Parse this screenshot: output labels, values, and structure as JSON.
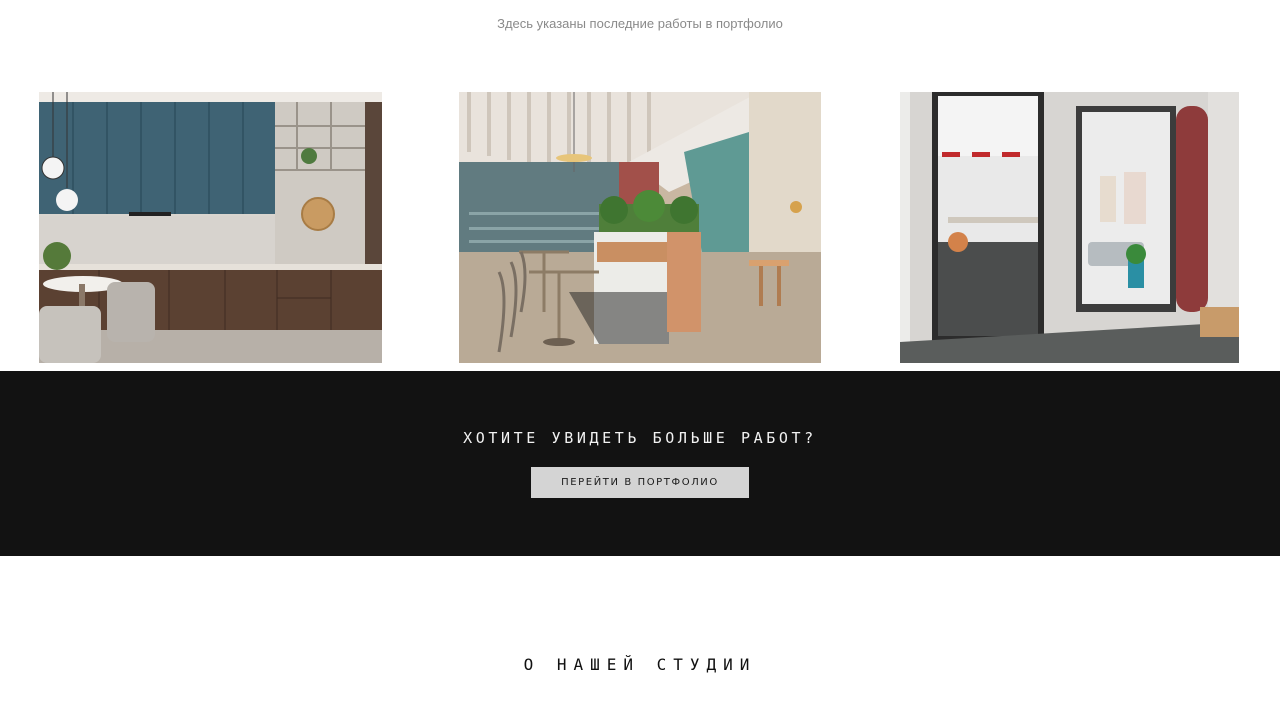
{
  "portfolio": {
    "subtitle": "Здесь указаны последние работы в портфолио",
    "items": [
      {
        "name": "kitchen-interior"
      },
      {
        "name": "restaurant-interior"
      },
      {
        "name": "office-interior"
      }
    ]
  },
  "cta": {
    "title": "ХОТИТЕ УВИДЕТЬ БОЛЬШЕ РАБОТ?",
    "button_label": "ПЕРЕЙТИ В ПОРТФОЛИО",
    "background_color": "#121212",
    "button_color": "#d4d4d4"
  },
  "about": {
    "title": "О НАШЕЙ СТУДИИ"
  }
}
